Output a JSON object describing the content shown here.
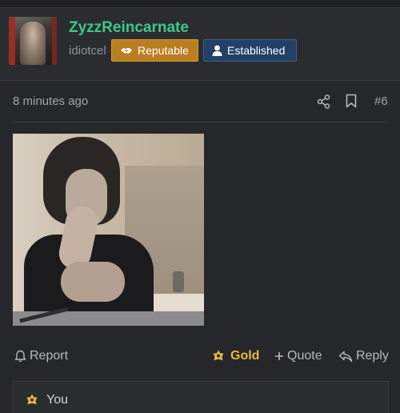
{
  "post": {
    "username": "ZyzzReincarnate",
    "user_title": "idiotcel",
    "badges": [
      {
        "label": "Reputable",
        "icon": "handshake-icon",
        "color": "#b97e22"
      },
      {
        "label": "Established",
        "icon": "user-icon",
        "color": "#234066"
      }
    ],
    "timestamp": "8 minutes ago",
    "post_number": "#6",
    "media_alt_icon": "image"
  },
  "actions": {
    "report": "Report",
    "gold": "Gold",
    "quote": "Quote",
    "reply": "Reply"
  },
  "reactions": {
    "who": "You"
  },
  "colors": {
    "username": "#3fc78a",
    "gold": "#e8b93a",
    "background": "#26272b"
  }
}
